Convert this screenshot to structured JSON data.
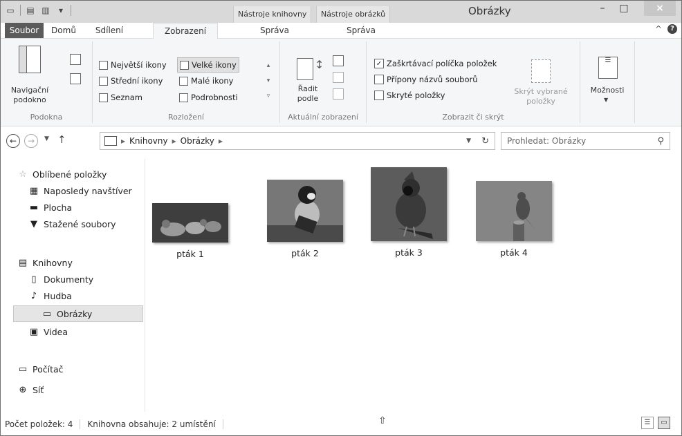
{
  "titlebar": {
    "title": "Obrázky",
    "context_tabs": [
      "Nástroje knihovny",
      "Nástroje obrázků"
    ],
    "minimize": "–",
    "maximize": "□",
    "close": "×"
  },
  "tabs": {
    "file": "Soubor",
    "home": "Domů",
    "share": "Sdílení",
    "view": "Zobrazení",
    "manage1": "Správa",
    "manage2": "Správa",
    "collapse": "^",
    "help": "?"
  },
  "ribbon": {
    "panes": {
      "nav_pane_label": "Navigační podokno",
      "group": "Podokna"
    },
    "layout": {
      "items": [
        "Největší ikony",
        "Velké ikony",
        "Střední ikony",
        "Malé ikony",
        "Seznam",
        "Podrobnosti"
      ],
      "selected": "Velké ikony",
      "group": "Rozložení"
    },
    "current_view": {
      "sort_by": "Řadit podle",
      "group": "Aktuální zobrazení"
    },
    "show_hide": {
      "checkboxes": [
        {
          "label": "Zaškrtávací políčka položek",
          "checked": true
        },
        {
          "label": "Přípony názvů souborů",
          "checked": false
        },
        {
          "label": "Skryté položky",
          "checked": false
        }
      ],
      "hide_selected": "Skrýt vybrané položky",
      "group": "Zobrazit či skrýt"
    },
    "options": {
      "label": "Možnosti"
    }
  },
  "nav": {
    "breadcrumb": [
      "Knihovny",
      "Obrázky"
    ],
    "search_placeholder": "Prohledat: Obrázky"
  },
  "sidebar": {
    "favorites": "Oblíbené položky",
    "recent": "Naposledy navštíver",
    "desktop": "Plocha",
    "downloads": "Stažené soubory",
    "libraries": "Knihovny",
    "documents": "Dokumenty",
    "music": "Hudba",
    "pictures": "Obrázky",
    "videos": "Videa",
    "computer": "Počítač",
    "network": "Síť"
  },
  "files": [
    {
      "name": "pták 1",
      "color": "#4a4a4a"
    },
    {
      "name": "pták 2",
      "color": "#6a6a6a"
    },
    {
      "name": "pták 3",
      "color": "#5a5a5a"
    },
    {
      "name": "pták 4",
      "color": "#7a7a7a"
    }
  ],
  "status": {
    "count": "Počet položek: 4",
    "locations": "Knihovna obsahuje: 2 umístění"
  }
}
